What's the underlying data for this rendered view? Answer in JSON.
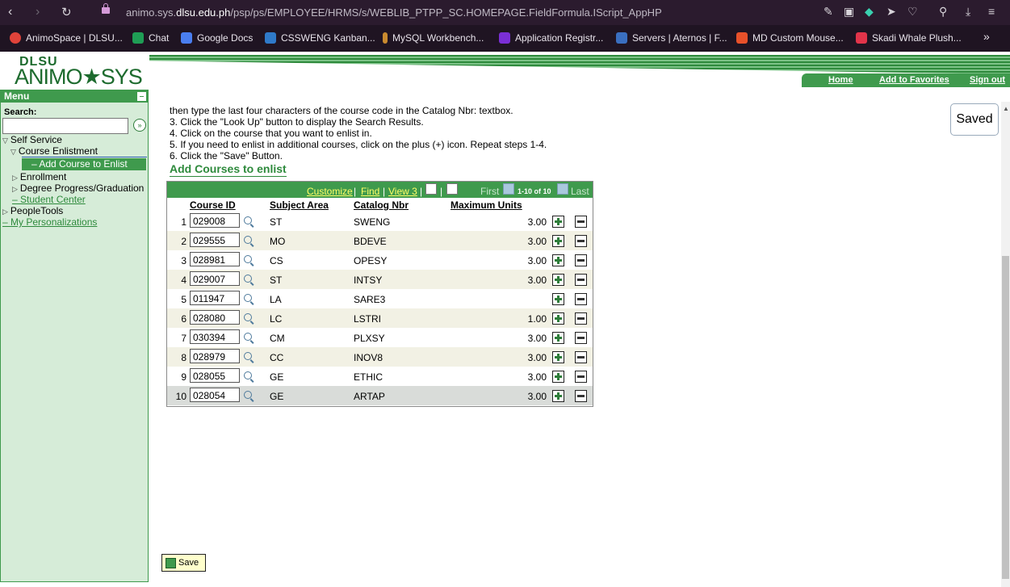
{
  "browser": {
    "url_prefix": "animo.sys.",
    "url_domain": "dlsu.edu.ph",
    "url_path": "/psp/ps/EMPLOYEE/HRMS/s/WEBLIB_PTPP_SC.HOMEPAGE.FieldFormula.IScript_AppHP",
    "bookmarks": [
      {
        "label": "AnimoSpace | DLSU...",
        "color": "#e0433a"
      },
      {
        "label": "Chat",
        "color": "#1f9d55"
      },
      {
        "label": "Google Docs",
        "color": "#4a7ef0"
      },
      {
        "label": "CSSWENG Kanban...",
        "color": "#2f7ac9"
      },
      {
        "label": "MySQL Workbench...",
        "color": "#c98a2f"
      },
      {
        "label": "Application Registr...",
        "color": "#7b2fd6"
      },
      {
        "label": "Servers | Aternos | F...",
        "color": "#3a6fc0"
      },
      {
        "label": "MD Custom Mouse...",
        "color": "#e8512a"
      },
      {
        "label": "Skadi Whale Plush...",
        "color": "#e2344a"
      }
    ],
    "more": "»"
  },
  "header": {
    "logo_top": "DLSU",
    "logo_main": "ANIMO★SYS",
    "links": [
      "Home",
      "Add to Favorites",
      "Sign out"
    ]
  },
  "sidebar": {
    "title": "Menu",
    "search_label": "Search:",
    "search_value": "",
    "search_go": "»",
    "items": [
      {
        "label": "Self Service"
      },
      {
        "label": "Course Enlistment"
      },
      {
        "label": "Add Course to Enlist"
      },
      {
        "label": "Enrollment"
      },
      {
        "label": "Degree Progress/Graduation"
      },
      {
        "label": "Student Center"
      },
      {
        "label": "PeopleTools"
      },
      {
        "label": "My Personalizations"
      }
    ]
  },
  "instructions": [
    "then type the last four characters of the course code in the Catalog Nbr: textbox.",
    "3. Click the \"Look Up\" button to display the Search Results.",
    "4. Click on the course that you want to enlist in.",
    "5. If you need to enlist in additional courses, click on the plus (+) icon. Repeat steps 1-4.",
    "6. Click the \"Save\" Button."
  ],
  "section_title": "Add Courses to enlist",
  "grid": {
    "customize": "Customize",
    "find": "Find",
    "view": "View 3",
    "first": "First",
    "count": "1-10 of 10",
    "last": "Last",
    "columns": [
      "Course ID",
      "Subject Area",
      "Catalog Nbr",
      "Maximum Units"
    ],
    "rows": [
      {
        "n": "1",
        "course_id": "029008",
        "subject": "ST",
        "catalog": "SWENG",
        "units": "3.00"
      },
      {
        "n": "2",
        "course_id": "029555",
        "subject": "MO",
        "catalog": "BDEVE",
        "units": "3.00"
      },
      {
        "n": "3",
        "course_id": "028981",
        "subject": "CS",
        "catalog": "OPESY",
        "units": "3.00"
      },
      {
        "n": "4",
        "course_id": "029007",
        "subject": "ST",
        "catalog": "INTSY",
        "units": "3.00"
      },
      {
        "n": "5",
        "course_id": "011947",
        "subject": "LA",
        "catalog": "SARE3",
        "units": ""
      },
      {
        "n": "6",
        "course_id": "028080",
        "subject": "LC",
        "catalog": "LSTRI",
        "units": "1.00"
      },
      {
        "n": "7",
        "course_id": "030394",
        "subject": "CM",
        "catalog": "PLXSY",
        "units": "3.00"
      },
      {
        "n": "8",
        "course_id": "028979",
        "subject": "CC",
        "catalog": "INOV8",
        "units": "3.00"
      },
      {
        "n": "9",
        "course_id": "028055",
        "subject": "GE",
        "catalog": "ETHIC",
        "units": "3.00"
      },
      {
        "n": "10",
        "course_id": "028054",
        "subject": "GE",
        "catalog": "ARTAP",
        "units": "3.00"
      }
    ]
  },
  "saved_label": "Saved",
  "save_button": "Save",
  "colors": {
    "brand_green": "#3f9a4d",
    "link_yellow": "#ffff66"
  }
}
